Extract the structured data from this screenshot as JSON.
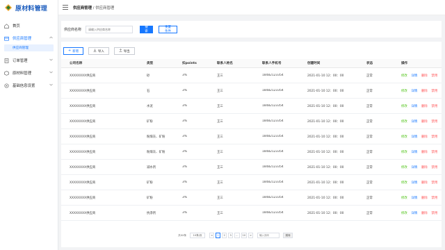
{
  "brand": {
    "title": "原材料管理"
  },
  "sidebar": {
    "items": [
      {
        "label": "首页",
        "icon": "home-icon",
        "expandable": false
      },
      {
        "label": "供应商管理",
        "icon": "supplier-icon",
        "expandable": true,
        "active": true,
        "chevron": "up"
      },
      {
        "label": "订单管理",
        "icon": "order-icon",
        "expandable": true,
        "chevron": "down"
      },
      {
        "label": "原材料管理",
        "icon": "material-icon",
        "expandable": true,
        "chevron": "down"
      },
      {
        "label": "基础信息设置",
        "icon": "settings-icon",
        "expandable": true,
        "chevron": "down"
      }
    ],
    "sub_item": "供应商管理"
  },
  "header": {
    "breadcrumb_parent": "供应商管理",
    "breadcrumb_sep": " / ",
    "breadcrumb_current": "供应商管理"
  },
  "search": {
    "label": "供应商名称",
    "placeholder": "请输入供应商名称",
    "search_button": "搜索",
    "reset_button": "重置条件"
  },
  "toolbar": {
    "add_label": "新增",
    "import_label": "导入",
    "export_label": "导出"
  },
  "table": {
    "columns": [
      "公司名称",
      "类型",
      "扣points",
      "联系人姓名",
      "联系人手机号",
      "创建时间",
      "状态",
      "操作"
    ],
    "rows": [
      [
        "XXXXXXXX供应商",
        "砂",
        "3%",
        "王三",
        "18482123354",
        "2021-01-10 12：00：00",
        "正常"
      ],
      [
        "XXXXXXXX供应商",
        "石",
        "3%",
        "王三",
        "18482123354",
        "2021-01-10 12：00：00",
        "正常"
      ],
      [
        "XXXXXXXX供应商",
        "水泥",
        "3%",
        "王三",
        "18482123354",
        "2021-01-10 12：00：00",
        "正常"
      ],
      [
        "XXXXXXXX供应商",
        "矿粉",
        "3%",
        "王三",
        "18482123354",
        "2021-01-10 12：00：00",
        "正常"
      ],
      [
        "XXXXXXXX供应商",
        "粉煤灰、矿粉",
        "3%",
        "王三",
        "18482123354",
        "2021-01-10 12：00：00",
        "正常"
      ],
      [
        "XXXXXXXX供应商",
        "粉煤灰、矿粉",
        "3%",
        "王三",
        "18482123354",
        "2021-01-10 12：00：00",
        "正常"
      ],
      [
        "XXXXXXXX供应商",
        "减水剂",
        "3%",
        "王三",
        "18482123354",
        "2021-01-10 12：00：00",
        "正常"
      ],
      [
        "XXXXXXXX供应商",
        "矿粉",
        "3%",
        "王三",
        "18482123354",
        "2021-01-10 12：00：00",
        "正常"
      ],
      [
        "XXXXXXXX供应商",
        "矿粉",
        "3%",
        "王三",
        "18482123354",
        "2021-01-10 12：00：00",
        "正常"
      ],
      [
        "XXXXXXXX供应商",
        "抗渗剂",
        "3%",
        "王三",
        "18482123354",
        "2021-01-10 12：00：00",
        "正常"
      ]
    ],
    "actions": [
      "修改",
      "详情",
      "删除",
      "禁用"
    ]
  },
  "pagination": {
    "total_text": "共XX条",
    "page_size": "10条/页",
    "prev": "<",
    "pages": [
      "1",
      "2",
      "3",
      "...",
      "10"
    ],
    "current": "1",
    "next": ">",
    "goto_placeholder": "输入页码",
    "jump_label": "跳转"
  },
  "colors": {
    "primary": "#1677ff",
    "brand_text": "#1f5fbf",
    "action_edit": "#52c41a",
    "action_detail": "#1677ff",
    "action_delete": "#ff4d4f",
    "action_disable": "#ff4d4f"
  }
}
